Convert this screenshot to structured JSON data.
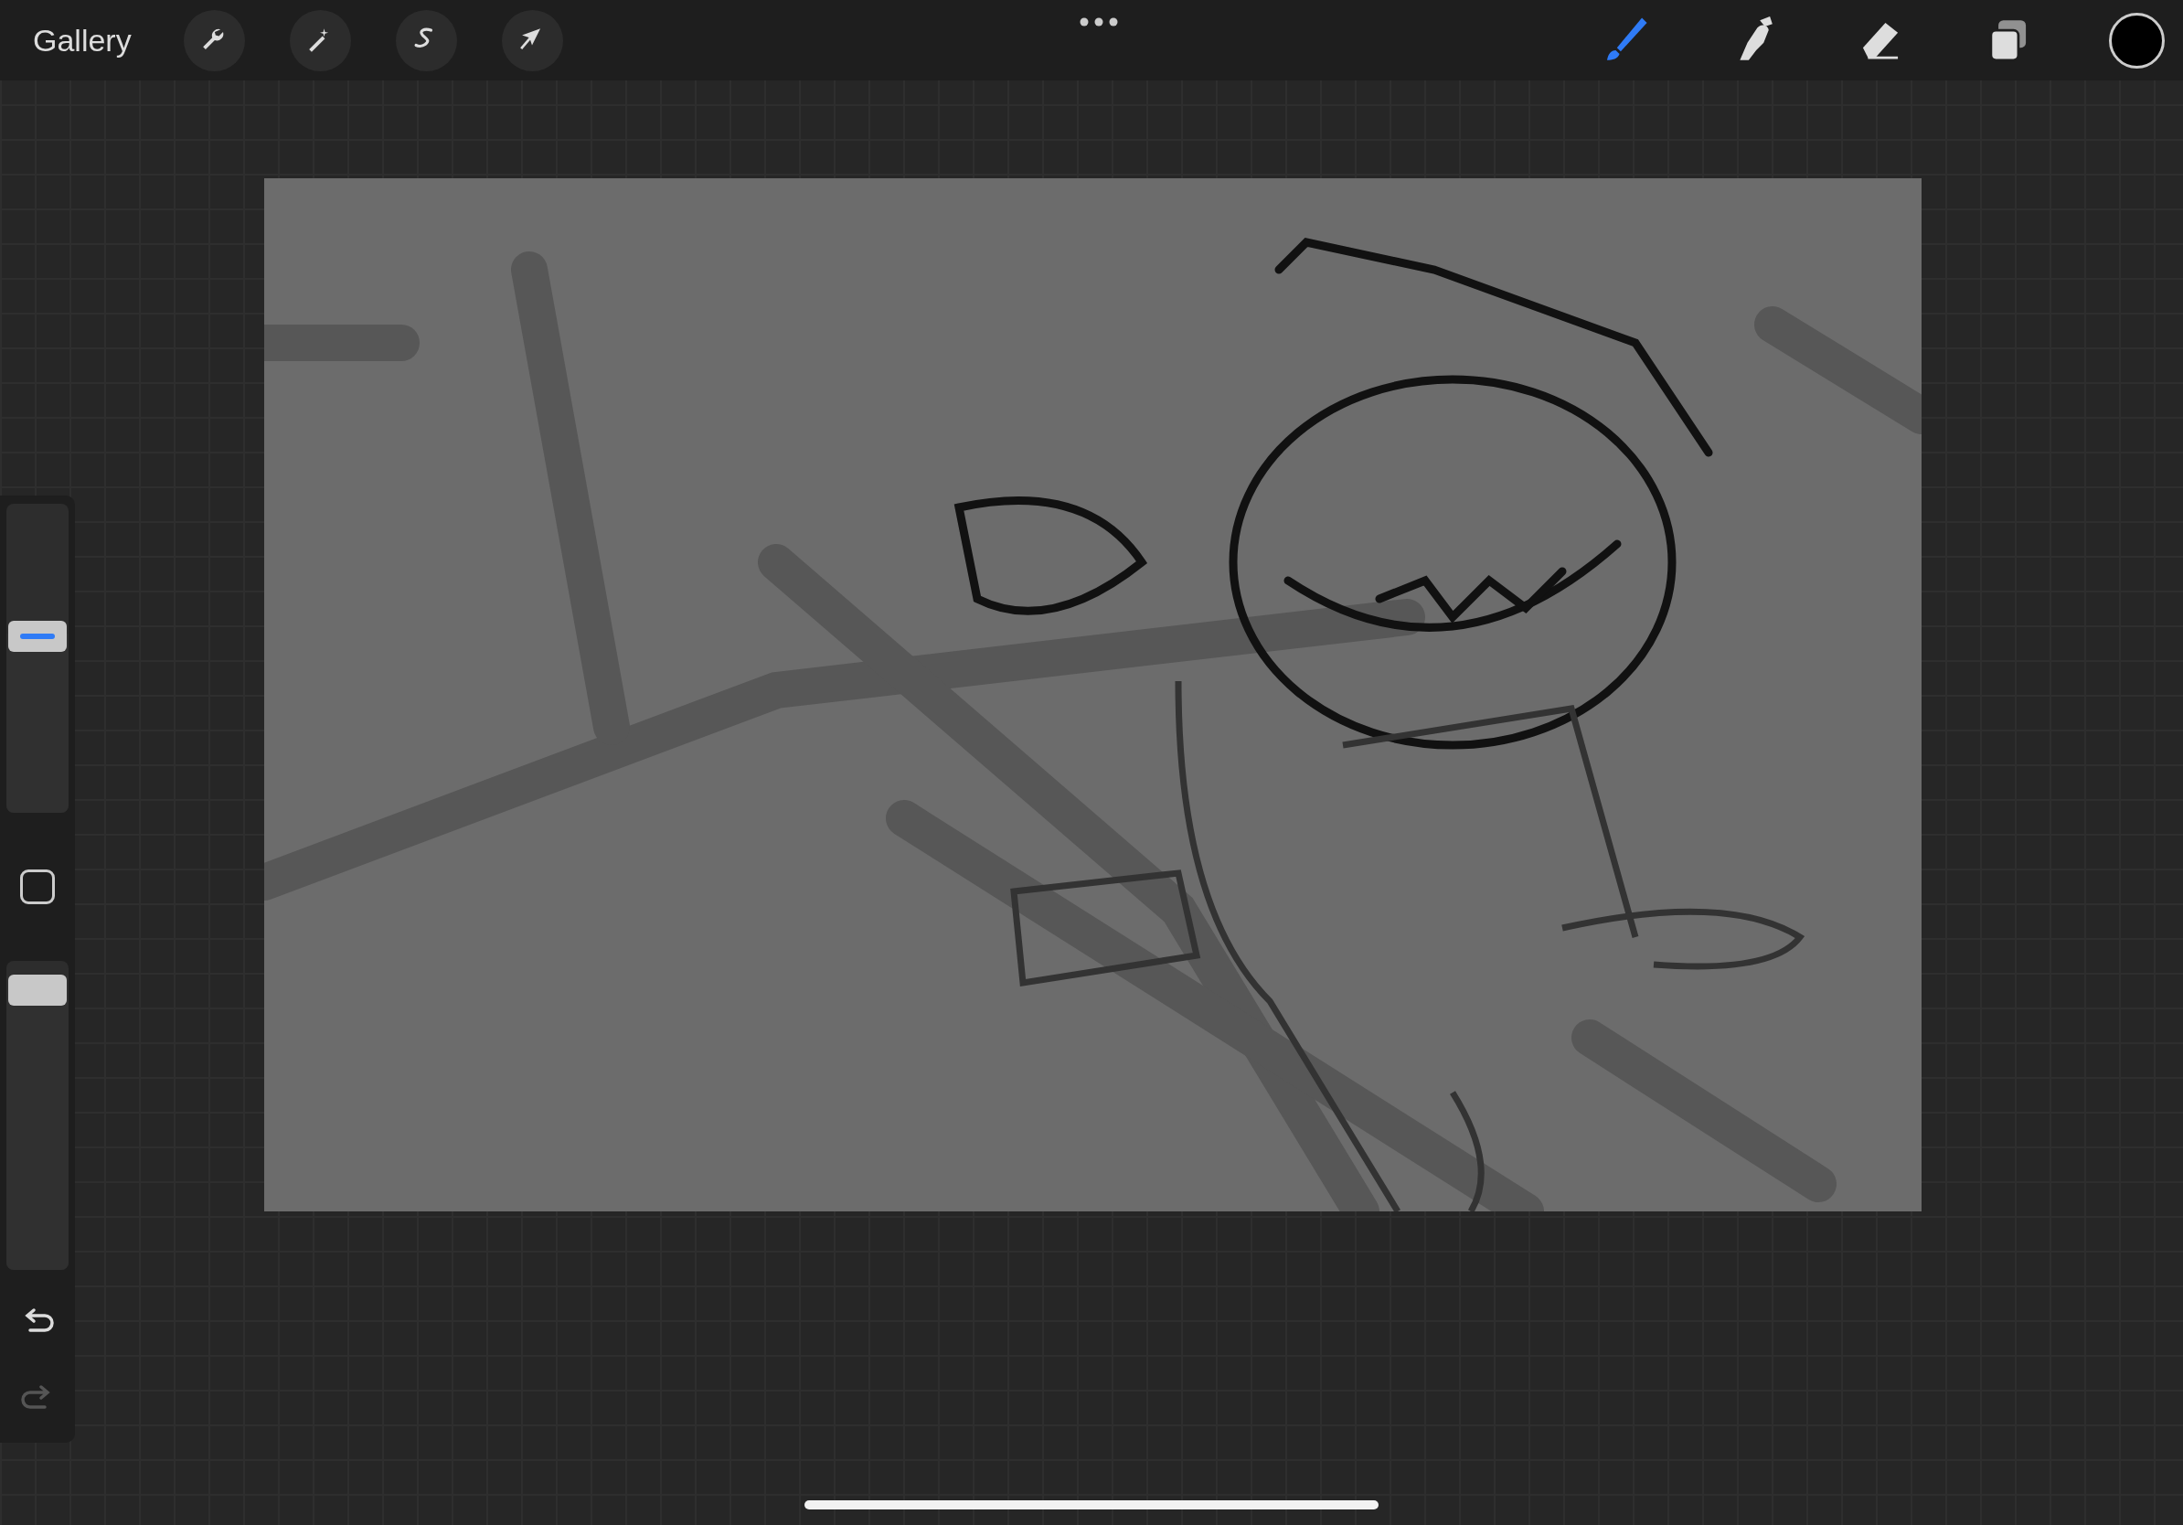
{
  "top_bar": {
    "gallery": "Gallery",
    "left_tools": [
      {
        "kind": "wrench"
      },
      {
        "kind": "wand"
      },
      {
        "kind": "selection"
      },
      {
        "kind": "transform"
      }
    ],
    "right_tools": [
      {
        "kind": "brush",
        "selected": true
      },
      {
        "kind": "smudge",
        "selected": false
      },
      {
        "kind": "eraser",
        "selected": false
      },
      {
        "kind": "layers",
        "selected": false
      }
    ],
    "color": "#000000"
  },
  "sidebar": {
    "brush_size": {
      "level": 0.58
    },
    "opacity": {
      "level": 0.95
    },
    "undo": {
      "disabled": false
    },
    "redo": {
      "disabled": true
    }
  }
}
